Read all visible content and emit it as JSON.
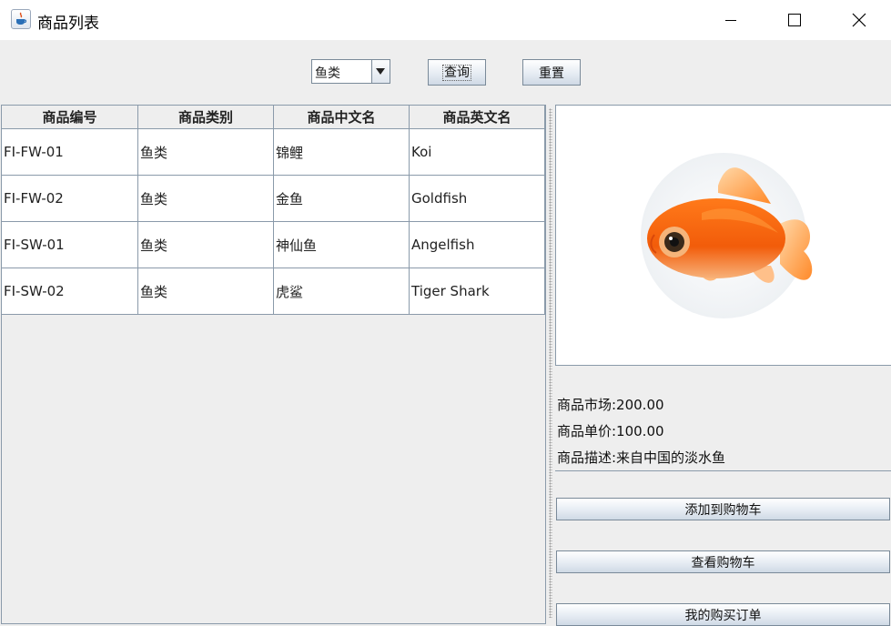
{
  "window": {
    "title": "商品列表",
    "icon": "java-cup-icon"
  },
  "toolbar": {
    "category_selected": "鱼类",
    "query_label": "查询",
    "reset_label": "重置"
  },
  "table": {
    "headers": [
      "商品编号",
      "商品类别",
      "商品中文名",
      "商品英文名"
    ],
    "rows": [
      [
        "FI-FW-01",
        "鱼类",
        "锦鲤",
        "Koi"
      ],
      [
        "FI-FW-02",
        "鱼类",
        "金鱼",
        "Goldfish"
      ],
      [
        "FI-SW-01",
        "鱼类",
        "神仙鱼",
        "Angelfish"
      ],
      [
        "FI-SW-02",
        "鱼类",
        "虎鲨",
        "Tiger Shark"
      ]
    ]
  },
  "detail": {
    "image": "goldfish-image",
    "market_price": "商品市场:200.00",
    "unit_price": "商品单价:100.00",
    "description": "商品描述:来自中国的淡水鱼",
    "add_to_cart_label": "添加到购物车",
    "view_cart_label": "查看购物车",
    "my_orders_label": "我的购买订单"
  }
}
